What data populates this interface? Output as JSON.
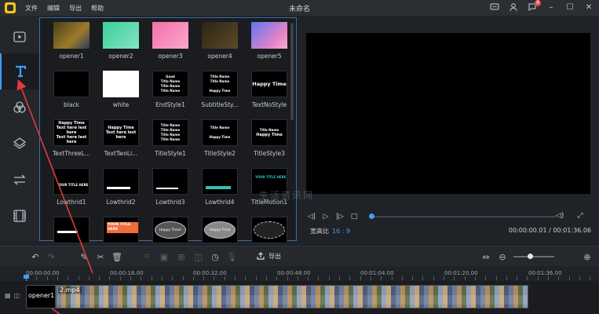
{
  "titlebar": {
    "menu": [
      "文件",
      "编辑",
      "导出",
      "帮助"
    ],
    "title": "未命名",
    "badge": "9"
  },
  "rail": {
    "items": [
      {
        "name": "media",
        "icon": "video-file-icon"
      },
      {
        "name": "text",
        "icon": "text-t-icon",
        "active": true
      },
      {
        "name": "filters",
        "icon": "filter-circles-icon"
      },
      {
        "name": "overlays",
        "icon": "layers-icon"
      },
      {
        "name": "transitions",
        "icon": "transition-arrows-icon"
      },
      {
        "name": "elements",
        "icon": "film-icon"
      }
    ]
  },
  "media": {
    "items": [
      {
        "label": "opener1",
        "thumb": "t-op1"
      },
      {
        "label": "opener2",
        "thumb": "t-op2"
      },
      {
        "label": "opener3",
        "thumb": "t-op3"
      },
      {
        "label": "opener4",
        "thumb": "t-op4"
      },
      {
        "label": "opener5",
        "thumb": "t-op5"
      },
      {
        "label": "black",
        "thumb": "t-dark"
      },
      {
        "label": "white",
        "thumb": "t-white"
      },
      {
        "label": "EndStyle1",
        "thumb": "t-dark"
      },
      {
        "label": "SubtitleSty...",
        "thumb": "t-dark"
      },
      {
        "label": "TextNoStyle",
        "thumb": "t-dark"
      },
      {
        "label": "TextThreeL...",
        "thumb": "t-dark"
      },
      {
        "label": "TextTwoLi...",
        "thumb": "t-dark"
      },
      {
        "label": "TitleStyle1",
        "thumb": "t-dark"
      },
      {
        "label": "TitleStyle2",
        "thumb": "t-dark"
      },
      {
        "label": "TitleStyle3",
        "thumb": "t-dark"
      },
      {
        "label": "Lowthrid1",
        "thumb": "t-dark"
      },
      {
        "label": "Lowthrid2",
        "thumb": "t-dark"
      },
      {
        "label": "Lowthrid3",
        "thumb": "t-dark"
      },
      {
        "label": "Lowthrid4",
        "thumb": "t-dark"
      },
      {
        "label": "TitleMotion1",
        "thumb": "t-dark"
      },
      {
        "label": "",
        "thumb": "t-dark"
      },
      {
        "label": "",
        "thumb": "t-dark"
      },
      {
        "label": "",
        "thumb": "t-dark"
      },
      {
        "label": "",
        "thumb": "t-dark"
      },
      {
        "label": "",
        "thumb": "t-dark"
      }
    ],
    "thumb_text": {
      "happy_time": "Happy Time",
      "text_here": "Text here lest here",
      "your_title": "YOUR TITLE HERE",
      "happy_time_excl": "Happy Time!",
      "happy_time_oval": "Happy Time"
    }
  },
  "watermark": "生活资讯网",
  "player": {
    "ratio_label": "宽高比",
    "ratio_value": "16 : 9",
    "time": "00:00:00.01 / 00:01:36.06"
  },
  "toolbar": {
    "export_label": "导出"
  },
  "ruler": {
    "labels": [
      "00:00:00.00",
      "00:00:16.00",
      "00:00:32.00",
      "00:00:48.00",
      "00:01:04.00",
      "00:01:20.00",
      "00:01:36.00"
    ]
  },
  "timeline": {
    "opener_clip": "opener1",
    "video_clip": "2.mp4"
  },
  "colors": {
    "accent": "#3aa0ff",
    "arrow": "#e23b3b"
  }
}
